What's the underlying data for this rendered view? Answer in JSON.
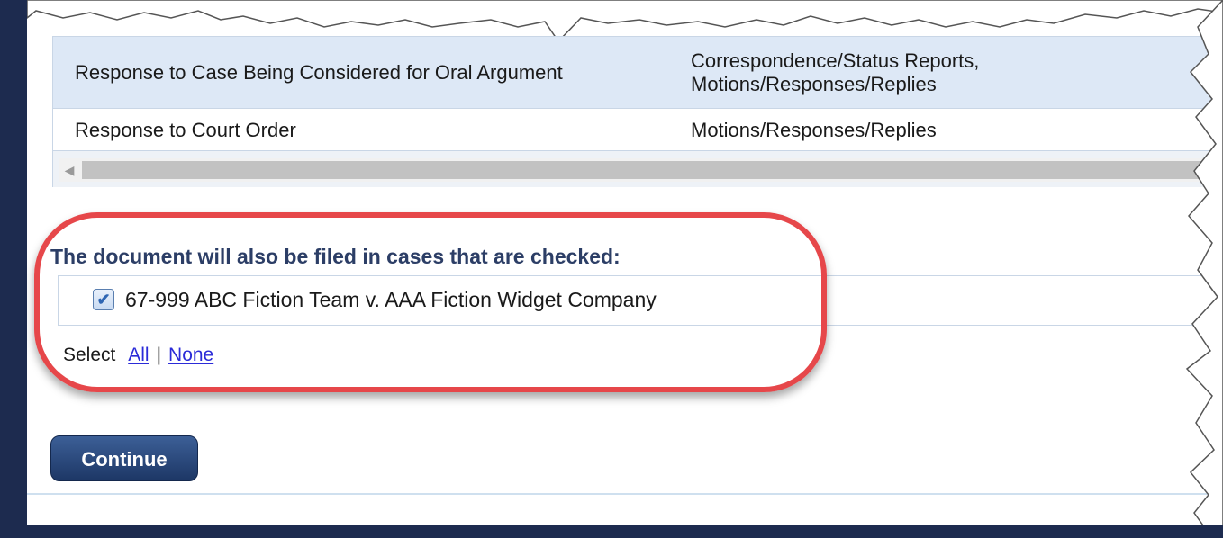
{
  "table": {
    "rows": [
      {
        "document_type": "Response to Case Being Considered for Oral Argument",
        "category_line1": "Correspondence/Status Reports,",
        "category_line2": "Motions/Responses/Replies"
      },
      {
        "document_type": "Response to Court Order",
        "category_line1": "Motions/Responses/Replies",
        "category_line2": ""
      }
    ],
    "scroll_left_icon": "chevron-left-icon"
  },
  "related_cases": {
    "heading": "The document will also be filed in cases that are checked:",
    "cases": [
      {
        "label": "67-999 ABC Fiction Team v. AAA Fiction Widget Company",
        "checked": true
      }
    ],
    "select_label": "Select",
    "select_all": "All",
    "select_separator": "|",
    "select_none": "None"
  },
  "actions": {
    "continue_label": "Continue"
  },
  "colors": {
    "frame": "#1d2b4f",
    "highlight": "#e6474a",
    "button": "#1d3766",
    "link": "#2b2bd8"
  }
}
